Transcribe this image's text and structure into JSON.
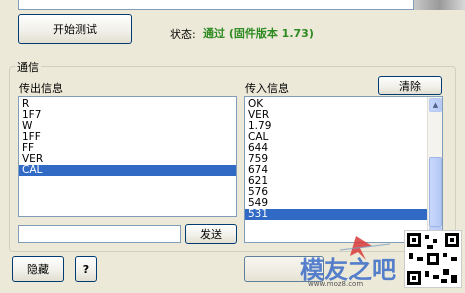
{
  "top": {
    "start_test_label": "开始测试",
    "status_label": "状态:",
    "status_value": "通过 (固件版本 1.73)"
  },
  "comm": {
    "group_label": "通信",
    "outgoing_label": "传出信息",
    "incoming_label": "传入信息",
    "clear_label": "清除",
    "outgoing_items": [
      "R",
      "1F7",
      "W",
      "1FF",
      "FF",
      "VER",
      "CAL"
    ],
    "outgoing_selected": "CAL",
    "incoming_items": [
      "OK",
      "VER",
      "1.79",
      "CAL",
      "644",
      "759",
      "674",
      "621",
      "576",
      "549",
      "531"
    ],
    "incoming_selected": "531",
    "send_input_value": "",
    "send_label": "发送"
  },
  "bottom": {
    "hide_label": "隐藏",
    "help_label": "?"
  },
  "watermark": {
    "brand": "模友之吧",
    "url": "www.moz8.com"
  },
  "colors": {
    "selection": "#316ac5",
    "status_green": "#2e8b22",
    "xp_face": "#ece9d8",
    "xp_border": "#003c74"
  }
}
